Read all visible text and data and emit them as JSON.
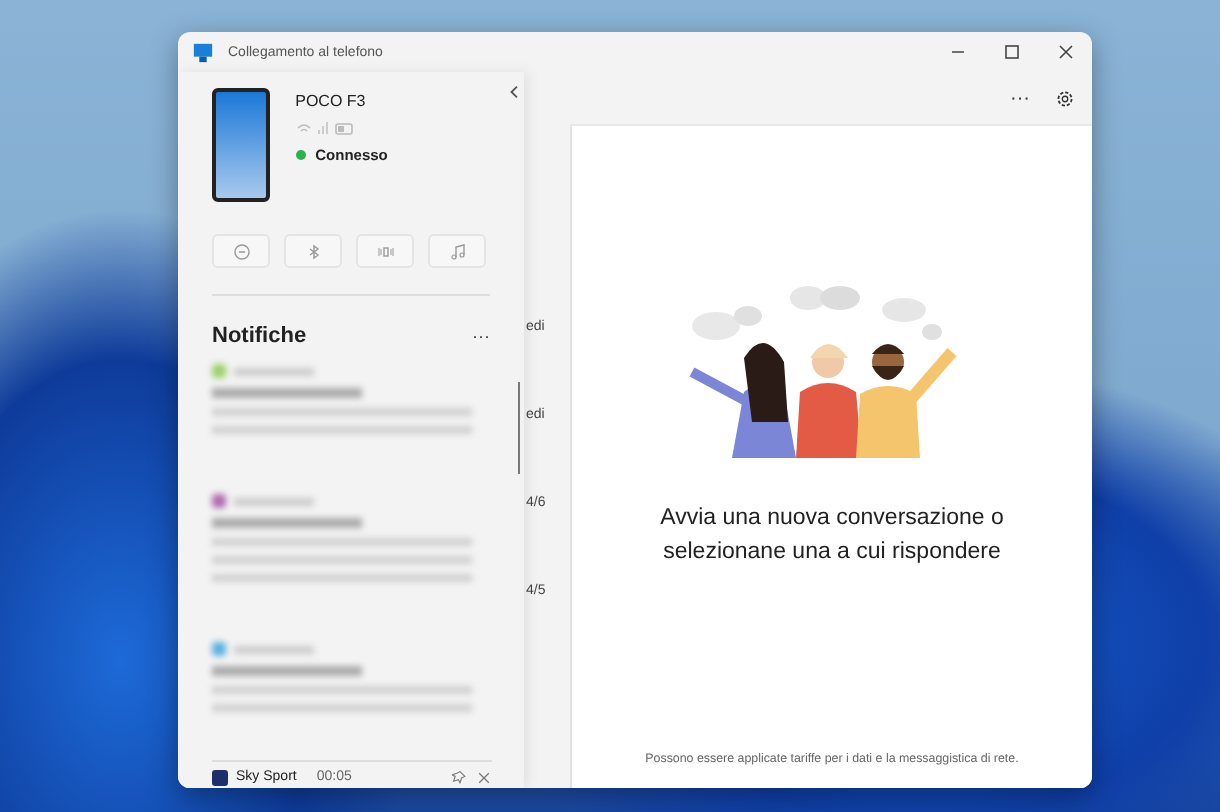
{
  "window": {
    "title": "Collegamento al telefono"
  },
  "device": {
    "name": "POCO F3",
    "status": "Connesso",
    "connected": true
  },
  "notifications": {
    "title": "Notifiche",
    "more": "···",
    "last_item": {
      "app": "Sky Sport",
      "time": "00:05"
    }
  },
  "conversation_dates": [
    "edi",
    "edi",
    "4/6",
    "4/5"
  ],
  "toolbar": {
    "more": "···"
  },
  "empty_state": {
    "message": "Avvia una nuova conversazione o selezionane una a cui rispondere"
  },
  "footer": "Possono essere applicate tariffe per i dati e la messaggistica di rete."
}
